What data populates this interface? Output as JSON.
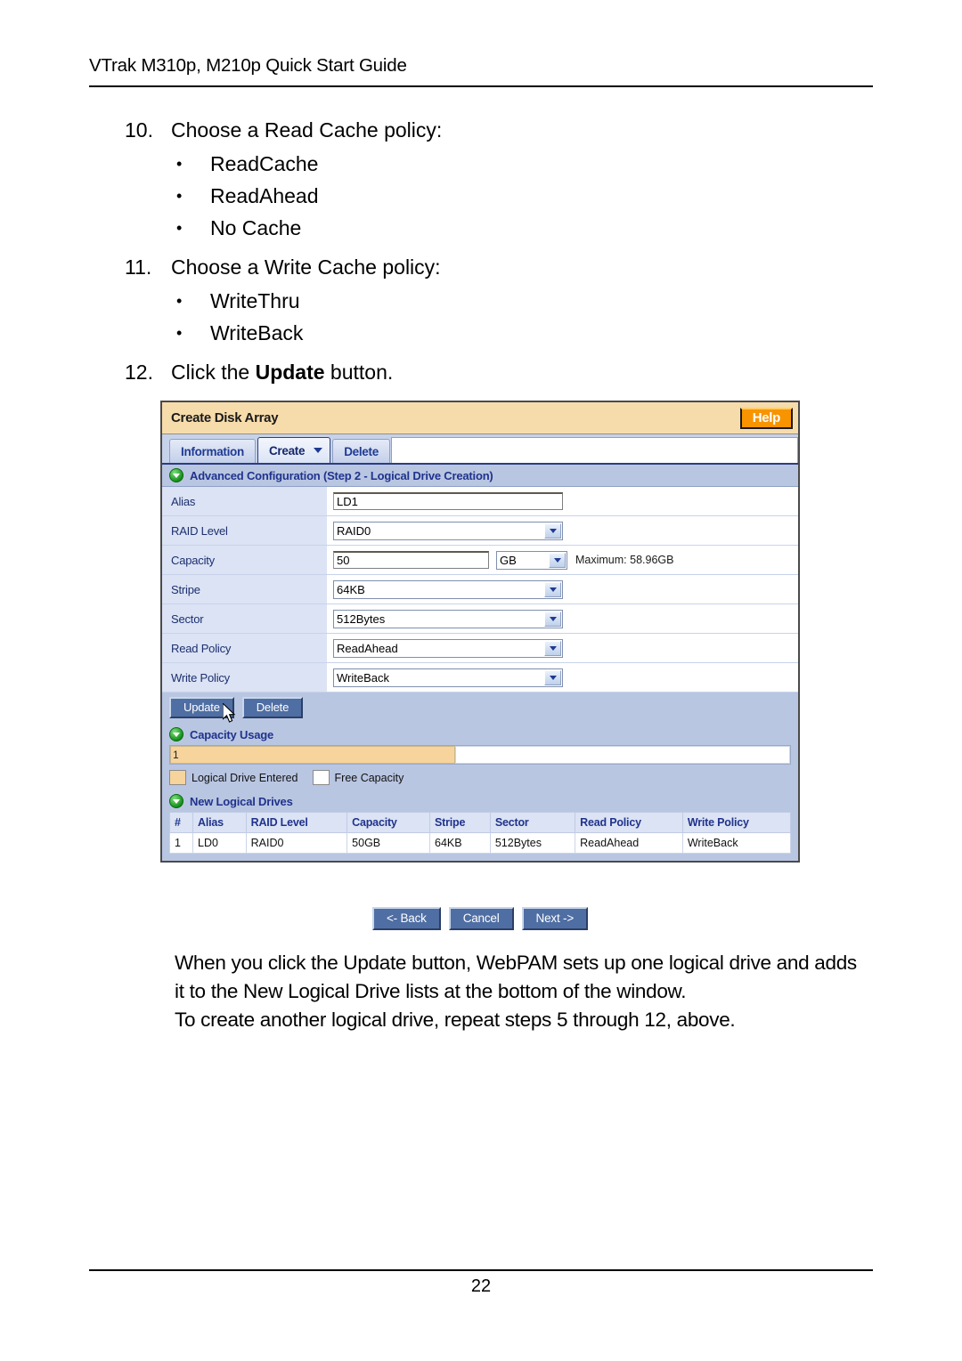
{
  "document": {
    "header": "VTrak M310p, M210p Quick Start Guide",
    "page_number": "22"
  },
  "steps": [
    {
      "number": "10.",
      "text": "Choose a Read Cache policy:",
      "bullets": [
        "ReadCache",
        "ReadAhead",
        "No Cache"
      ]
    },
    {
      "number": "11.",
      "text": "Choose a Write Cache policy:",
      "bullets": [
        "WriteThru",
        "WriteBack"
      ]
    },
    {
      "number": "12.",
      "prefix": "Click the ",
      "bold": "Update",
      "suffix": " button."
    }
  ],
  "screenshot": {
    "title": "Create Disk Array",
    "help_label": "Help",
    "tabs": [
      {
        "label": "Information",
        "active": false
      },
      {
        "label": "Create",
        "active": true
      },
      {
        "label": "Delete",
        "active": false
      }
    ],
    "advanced_section": {
      "heading": "Advanced Configuration (Step 2 - Logical Drive Creation)",
      "icon": "expand-collapse-icon",
      "fields": [
        {
          "label": "Alias",
          "type": "text",
          "value": "LD1"
        },
        {
          "label": "RAID Level",
          "type": "select",
          "value": "RAID0"
        },
        {
          "label": "Capacity",
          "type": "text-unit",
          "value": "50",
          "unit": "GB",
          "note": "Maximum: 58.96GB"
        },
        {
          "label": "Stripe",
          "type": "select",
          "value": "64KB"
        },
        {
          "label": "Sector",
          "type": "select",
          "value": "512Bytes"
        },
        {
          "label": "Read Policy",
          "type": "select",
          "value": "ReadAhead"
        },
        {
          "label": "Write Policy",
          "type": "select",
          "value": "WriteBack"
        }
      ],
      "buttons": [
        {
          "label": "Update"
        },
        {
          "label": "Delete"
        }
      ]
    },
    "capacity_usage": {
      "heading": "Capacity Usage",
      "bar_label": "1",
      "used_percent": 46,
      "legend": [
        {
          "label": "Logical Drive Entered",
          "color": "#f7d49c"
        },
        {
          "label": "Free Capacity",
          "color": "#ffffff"
        }
      ]
    },
    "new_logical_drives": {
      "heading": "New Logical Drives",
      "columns": [
        "#",
        "Alias",
        "RAID Level",
        "Capacity",
        "Stripe",
        "Sector",
        "Read Policy",
        "Write Policy"
      ],
      "rows": [
        [
          "1",
          "LD0",
          "RAID0",
          "50GB",
          "64KB",
          "512Bytes",
          "ReadAhead",
          "WriteBack"
        ]
      ]
    },
    "nav_buttons": [
      "<- Back",
      "Cancel",
      "Next ->"
    ],
    "colors": {
      "title_bar": "#f7dcab",
      "help_button": "#f79400",
      "panel_body": "#b9c6e2",
      "label_cell": "#dbe3f4",
      "heading_text": "#20338c",
      "button_face": "#4f6ea3",
      "capacity_used": "#f7d49c"
    }
  },
  "paragraphs": {
    "p1": "When you click the Update button, WebPAM sets up one logical drive and adds it to the New Logical Drive lists at the bottom of the window.",
    "p2": "To create another logical drive, repeat steps 5 through 12, above."
  }
}
